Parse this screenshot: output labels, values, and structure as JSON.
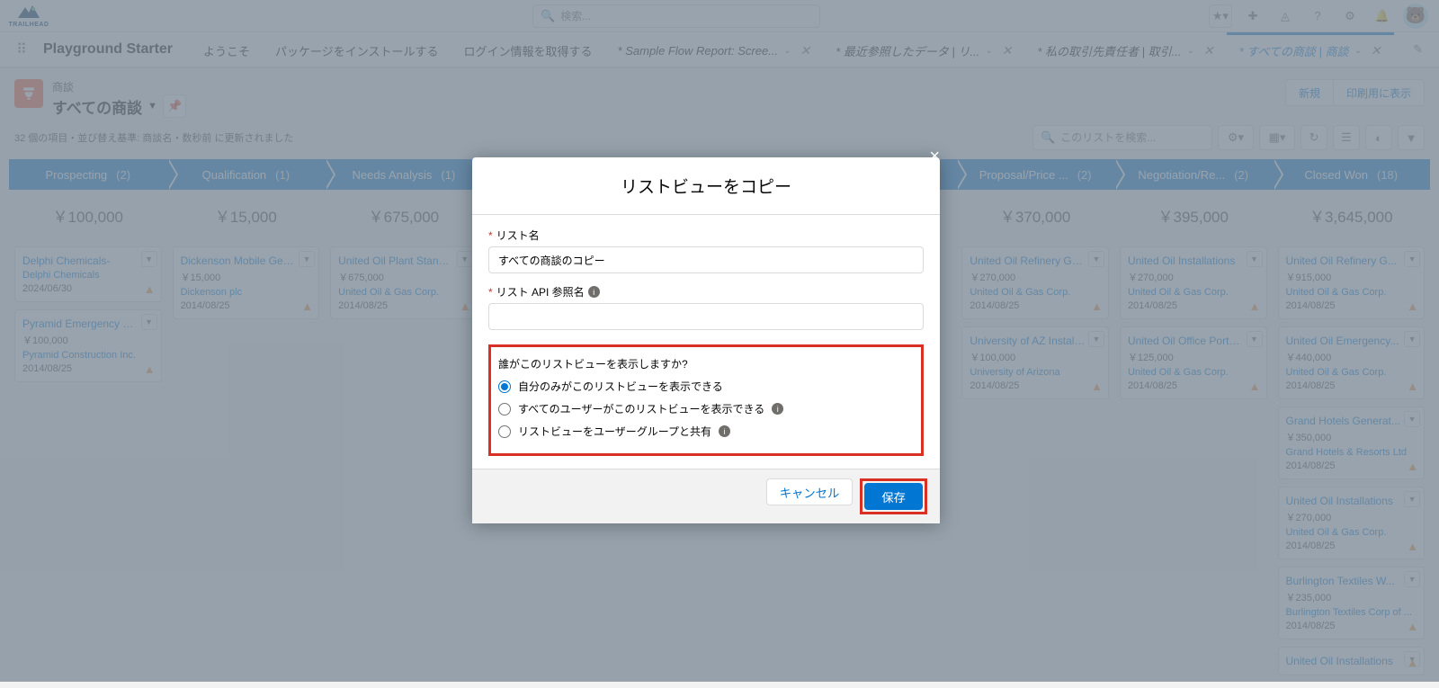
{
  "header": {
    "logo_text": "TRAILHEAD",
    "search_placeholder": "検索..."
  },
  "nav": {
    "app_name": "Playground Starter",
    "tabs": [
      {
        "label": "ようこそ",
        "closable": false
      },
      {
        "label": "パッケージをインストールする",
        "closable": false
      },
      {
        "label": "ログイン情報を取得する",
        "closable": false
      },
      {
        "label": "* Sample Flow Report: Scree...",
        "closable": true,
        "italic": true
      },
      {
        "label": "* 最近参照したデータ | リ...",
        "closable": true,
        "italic": true
      },
      {
        "label": "* 私の取引先責任者 | 取引...",
        "closable": true,
        "italic": true
      },
      {
        "label": "* すべての商談 | 商談",
        "closable": true,
        "italic": true,
        "active": true
      }
    ]
  },
  "object": {
    "label": "商談",
    "title": "すべての商談",
    "new_btn": "新規",
    "print_btn": "印刷用に表示"
  },
  "meta": {
    "text": "32 個の項目・並び替え基準: 商談名・数秒前 に更新されました",
    "list_search_placeholder": "このリストを検索..."
  },
  "stages": [
    {
      "name": "Prospecting",
      "count": "(2)",
      "sum": "￥100,000"
    },
    {
      "name": "Qualification",
      "count": "(1)",
      "sum": "￥15,000"
    },
    {
      "name": "Needs Analysis",
      "count": "(1)",
      "sum": "￥675,000"
    },
    {
      "name": "",
      "count": "",
      "sum": ""
    },
    {
      "name": "",
      "count": "",
      "sum": ""
    },
    {
      "name": "",
      "count": "",
      "sum": ""
    },
    {
      "name": "Proposal/Price ...",
      "count": "(2)",
      "sum": "￥370,000"
    },
    {
      "name": "Negotiation/Re...",
      "count": "(2)",
      "sum": "￥395,000"
    },
    {
      "name": "Closed Won",
      "count": "(18)",
      "sum": "￥3,645,000"
    }
  ],
  "cards": {
    "0": [
      {
        "title": "Delphi Chemicals-",
        "amount": "",
        "account": "Delphi Chemicals",
        "date": "2024/06/30"
      },
      {
        "title": "Pyramid Emergency Gen...",
        "amount": "￥100,000",
        "account": "Pyramid Construction Inc.",
        "date": "2014/08/25"
      }
    ],
    "1": [
      {
        "title": "Dickenson Mobile Gener...",
        "amount": "￥15,000",
        "account": "Dickenson plc",
        "date": "2014/08/25"
      }
    ],
    "2": [
      {
        "title": "United Oil Plant Standby...",
        "amount": "￥675,000",
        "account": "United Oil & Gas Corp.",
        "date": "2014/08/25"
      }
    ],
    "6": [
      {
        "title": "United Oil Refinery Gene...",
        "amount": "￥270,000",
        "account": "United Oil & Gas Corp.",
        "date": "2014/08/25"
      },
      {
        "title": "University of AZ Installati...",
        "amount": "￥100,000",
        "account": "University of Arizona",
        "date": "2014/08/25"
      }
    ],
    "7": [
      {
        "title": "United Oil Installations",
        "amount": "￥270,000",
        "account": "United Oil & Gas Corp.",
        "date": "2014/08/25"
      },
      {
        "title": "United Oil Office Portabl...",
        "amount": "￥125,000",
        "account": "United Oil & Gas Corp.",
        "date": "2014/08/25"
      }
    ],
    "8": [
      {
        "title": "United Oil Refinery G...",
        "amount": "￥915,000",
        "account": "United Oil & Gas Corp.",
        "date": "2014/08/25"
      },
      {
        "title": "United Oil Emergency...",
        "amount": "￥440,000",
        "account": "United Oil & Gas Corp.",
        "date": "2014/08/25"
      },
      {
        "title": "Grand Hotels Generat...",
        "amount": "￥350,000",
        "account": "Grand Hotels & Resorts Ltd",
        "date": "2014/08/25"
      },
      {
        "title": "United Oil Installations",
        "amount": "￥270,000",
        "account": "United Oil & Gas Corp.",
        "date": "2014/08/25"
      },
      {
        "title": "Burlington Textiles W...",
        "amount": "￥235,000",
        "account": "Burlington Textiles Corp of ...",
        "date": "2014/08/25"
      },
      {
        "title": "United Oil Installations",
        "amount": "",
        "account": "",
        "date": ""
      }
    ]
  },
  "modal": {
    "title": "リストビューをコピー",
    "list_name_label": "リスト名",
    "list_name_value": "すべての商談のコピー",
    "api_name_label": "リスト API 参照名",
    "who_label": "誰がこのリストビューを表示しますか?",
    "radio1": "自分のみがこのリストビューを表示できる",
    "radio2": "すべてのユーザーがこのリストビューを表示できる",
    "radio3": "リストビューをユーザーグループと共有",
    "cancel": "キャンセル",
    "save": "保存"
  }
}
